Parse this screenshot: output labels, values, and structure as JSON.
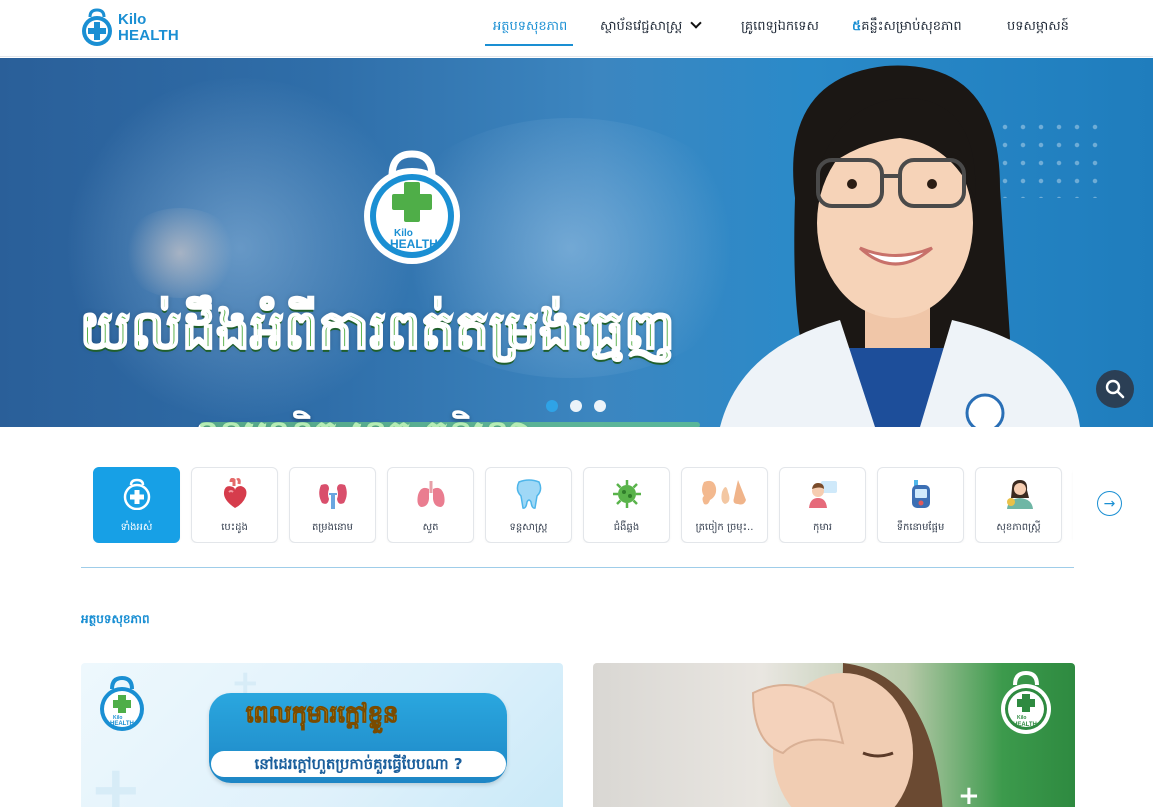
{
  "brand": {
    "line1": "Kilo",
    "line2": "HEALTH"
  },
  "nav": {
    "items": [
      {
        "label": "អត្ថបទសុខភាព",
        "active": true
      },
      {
        "label": "ស្ថាប័នវេជ្ជសាស្ត្រ",
        "has_dropdown": true
      },
      {
        "label": "គ្រូពេទ្យឯកទេស"
      },
      {
        "prefix": "៥",
        "label": "គន្លឹះសម្រាប់សុខភាព"
      },
      {
        "label": "បទសម្ភាសន៍"
      }
    ]
  },
  "hero": {
    "badge_line1": "Kilo",
    "badge_line2": "HEALTH",
    "title": "យល់ដឹងអំពីការពត់តម្រង់ធ្មេញ",
    "subtitle": "ទន្តបណ្ឌិត ហួត កន្និហ្សា",
    "slide_count": 3,
    "active_slide": 1
  },
  "categories": [
    {
      "label": "ទាំងអស់",
      "icon": "all-icon",
      "active": true
    },
    {
      "label": "បេះដូង",
      "icon": "heart-icon"
    },
    {
      "label": "តម្រងនោម",
      "icon": "kidney-icon"
    },
    {
      "label": "សួត",
      "icon": "lungs-icon"
    },
    {
      "label": "ទន្តសាស្ត្រ",
      "icon": "tooth-icon"
    },
    {
      "label": "ជំងឺឆ្លង",
      "icon": "virus-icon"
    },
    {
      "label": "ត្រចៀក ច្រមុះ..",
      "icon": "ear-nose-icon"
    },
    {
      "label": "កុមារ",
      "icon": "child-icon"
    },
    {
      "label": "ទឹកនោមផ្អែម",
      "icon": "glucose-meter-icon"
    },
    {
      "label": "សុខភាពស្ត្រី",
      "icon": "woman-health-icon"
    }
  ],
  "section": {
    "title": "អត្ថបទសុខភាព"
  },
  "articles": [
    {
      "brand1": "Kilo",
      "brand2": "HEALTH",
      "headline": "ពេលកុមារក្តៅខ្លួន",
      "subline": "នៅដេរក្តៅហួតប្រកាច់គួរធ្វើបែបណា ?"
    },
    {
      "brand1": "Kilo",
      "brand2": "HEALTH"
    }
  ],
  "colors": {
    "accent": "#1a8fd3",
    "category_active": "#17a0e6",
    "hero_title_green": "#58b04a"
  }
}
